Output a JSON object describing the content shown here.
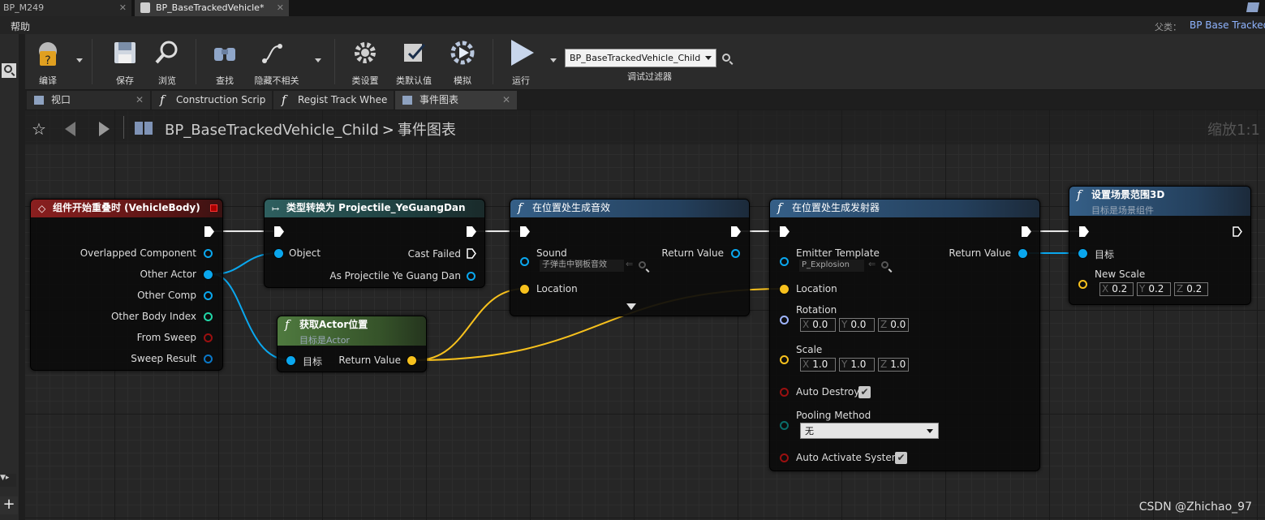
{
  "doc_tabs": {
    "tab1": "BP_M249",
    "tab2": "BP_BaseTrackedVehicle*"
  },
  "menu": {
    "help": "帮助",
    "parent_label": "父类：",
    "parent_value": "BP Base Tracked"
  },
  "toolbar": {
    "compile": "编译",
    "save": "保存",
    "browse": "浏览",
    "find": "查找",
    "hide_unrelated": "隐藏不相关",
    "class_settings": "类设置",
    "class_defaults": "类默认值",
    "simulate": "模拟",
    "run": "运行",
    "debug_filter_value": "BP_BaseTrackedVehicle_Child",
    "debug_filter_label": "调试过滤器"
  },
  "editor_tabs": [
    "视口",
    "Construction Scrip",
    "Regist Track Whee",
    "事件图表"
  ],
  "breadcrumb": {
    "blueprint": "BP_BaseTrackedVehicle_Child",
    "graph": "事件图表",
    "sep": ">"
  },
  "zoom": "缩放1:1",
  "nodes": {
    "overlap": {
      "title": "组件开始重叠时 (VehicleBody)",
      "pins": [
        "Overlapped Component",
        "Other Actor",
        "Other Comp",
        "Other Body Index",
        "From Sweep",
        "Sweep Result"
      ]
    },
    "cast": {
      "title": "类型转换为 Projectile_YeGuangDan",
      "object": "Object",
      "cast_failed": "Cast Failed",
      "as": "As Projectile Ye Guang Dan"
    },
    "getloc": {
      "title": "获取Actor位置",
      "subtitle": "目标是Actor",
      "target": "目标",
      "ret": "Return Value"
    },
    "sound": {
      "title": "在位置处生成音效",
      "sound": "Sound",
      "sound_asset": "子弹击中钢板音效",
      "ret": "Return Value",
      "location": "Location"
    },
    "emitter": {
      "title": "在位置处生成发射器",
      "template": "Emitter Template",
      "template_asset": "P_Explosion",
      "ret": "Return Value",
      "location": "Location",
      "rotation": "Rotation",
      "rot": [
        "0.0",
        "0.0",
        "0.0"
      ],
      "scale": "Scale",
      "scl": [
        "1.0",
        "1.0",
        "1.0"
      ],
      "auto_destroy": "Auto Destroy",
      "pooling": "Pooling Method",
      "pooling_value": "无",
      "auto_activate": "Auto Activate System"
    },
    "setscale": {
      "title": "设置场景范围3D",
      "subtitle": "目标是场景组件",
      "target": "目标",
      "new_scale": "New Scale",
      "vals": [
        "0.2",
        "0.2",
        "0.2"
      ]
    }
  },
  "axes": [
    "X",
    "Y",
    "Z"
  ],
  "watermark": "CSDN @Zhichao_97",
  "colors": {
    "object_pin": "#0aa7ee",
    "vector_pin": "#f7c11d",
    "rotator_pin": "#9fb5ff",
    "int_pin": "#22d6a8",
    "bool_pin": "#9a1010",
    "struct_pin": "#0a78c8",
    "byte_pin": "#0a6d6a"
  }
}
